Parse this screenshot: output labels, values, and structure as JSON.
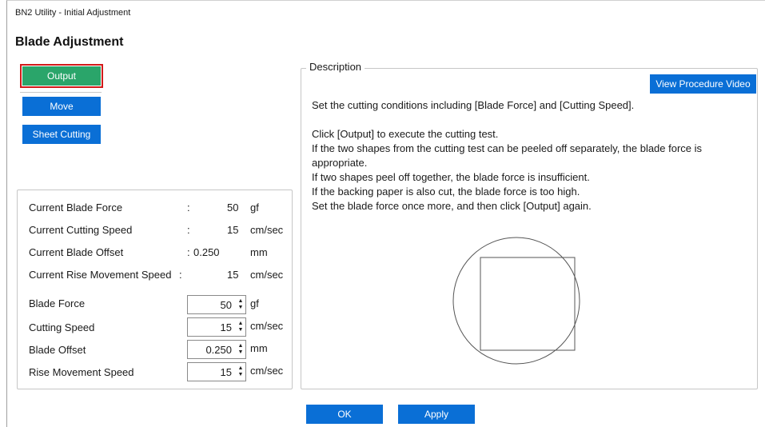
{
  "window": {
    "title": "BN2 Utility - Initial Adjustment"
  },
  "page": {
    "title": "Blade Adjustment"
  },
  "actions": {
    "output_label": "Output",
    "move_label": "Move",
    "sheet_cutting_label": "Sheet Cutting"
  },
  "current": [
    {
      "label": "Current Blade Force",
      "colon": ":",
      "value": "50",
      "unit": "gf"
    },
    {
      "label": "Current Cutting Speed",
      "colon": ":",
      "value": "15",
      "unit": "cm/sec"
    },
    {
      "label": "Current Blade Offset",
      "colon": ":",
      "value": "0.250",
      "unit": "mm"
    },
    {
      "label": "Current Rise Movement Speed",
      "colon": ":",
      "value": "15",
      "unit": "cm/sec"
    }
  ],
  "settings": [
    {
      "label": "Blade Force",
      "colon": ":",
      "value": "50",
      "unit": "gf"
    },
    {
      "label": "Cutting Speed",
      "colon": ":",
      "value": "15",
      "unit": "cm/sec"
    },
    {
      "label": "Blade Offset",
      "colon": ":",
      "value": "0.250",
      "unit": "mm"
    },
    {
      "label": "Rise Movement Speed",
      "colon": ":",
      "value": "15",
      "unit": "cm/sec"
    }
  ],
  "description": {
    "legend": "Description",
    "video_button": "View Procedure Video",
    "line1": "Set the cutting conditions including [Blade Force] and [Cutting Speed].",
    "line2": "Click [Output] to execute the cutting test.",
    "line3": "If the two shapes from the cutting test can be peeled off separately, the blade force is appropriate.",
    "line4": "If two shapes peel off together, the blade force is insufficient.",
    "line5": "If the backing paper is also cut, the blade force is too high.",
    "line6": "Set the blade force once more, and then click [Output] again."
  },
  "footer": {
    "ok_label": "OK",
    "apply_label": "Apply"
  },
  "colors": {
    "accent_blue": "#0a6fd6",
    "output_green": "#2aa56a",
    "focus_red": "#d21a1a"
  }
}
